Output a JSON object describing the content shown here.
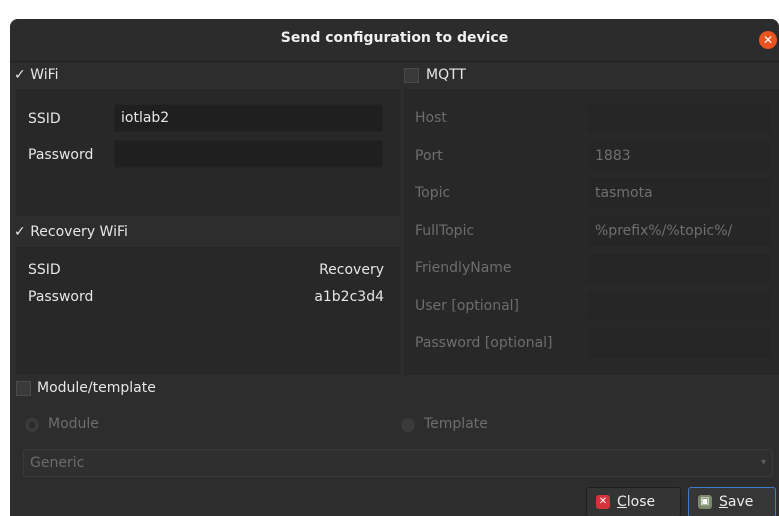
{
  "dialog": {
    "title": "Send configuration to device"
  },
  "wifi": {
    "header": "WiFi",
    "check_mark": "✓",
    "ssid_label": "SSID",
    "ssid_value": "iotlab2",
    "password_label": "Password",
    "password_value": ""
  },
  "recovery": {
    "header": "Recovery WiFi",
    "check_mark": "✓",
    "ssid_label": "SSID",
    "ssid_value": "Recovery",
    "password_label": "Password",
    "password_value": "a1b2c3d4"
  },
  "mqtt": {
    "header": "MQTT",
    "fields": [
      {
        "label": "Host",
        "value": ""
      },
      {
        "label": "Port",
        "value": "1883"
      },
      {
        "label": "Topic",
        "value": "tasmota"
      },
      {
        "label": "FullTopic",
        "value": "%prefix%/%topic%/"
      },
      {
        "label": "FriendlyName",
        "value": ""
      },
      {
        "label": "User [optional]",
        "value": ""
      },
      {
        "label": "Password [optional]",
        "value": ""
      }
    ]
  },
  "module_template": {
    "header": "Module/template",
    "module_label": "Module",
    "template_label": "Template",
    "select_value": "Generic"
  },
  "buttons": {
    "close_mnemonic": "C",
    "close_rest": "lose",
    "save_mnemonic": "S",
    "save_rest": "ave"
  },
  "colors": {
    "accent": "#e95420",
    "focus": "#3d7cc9"
  }
}
